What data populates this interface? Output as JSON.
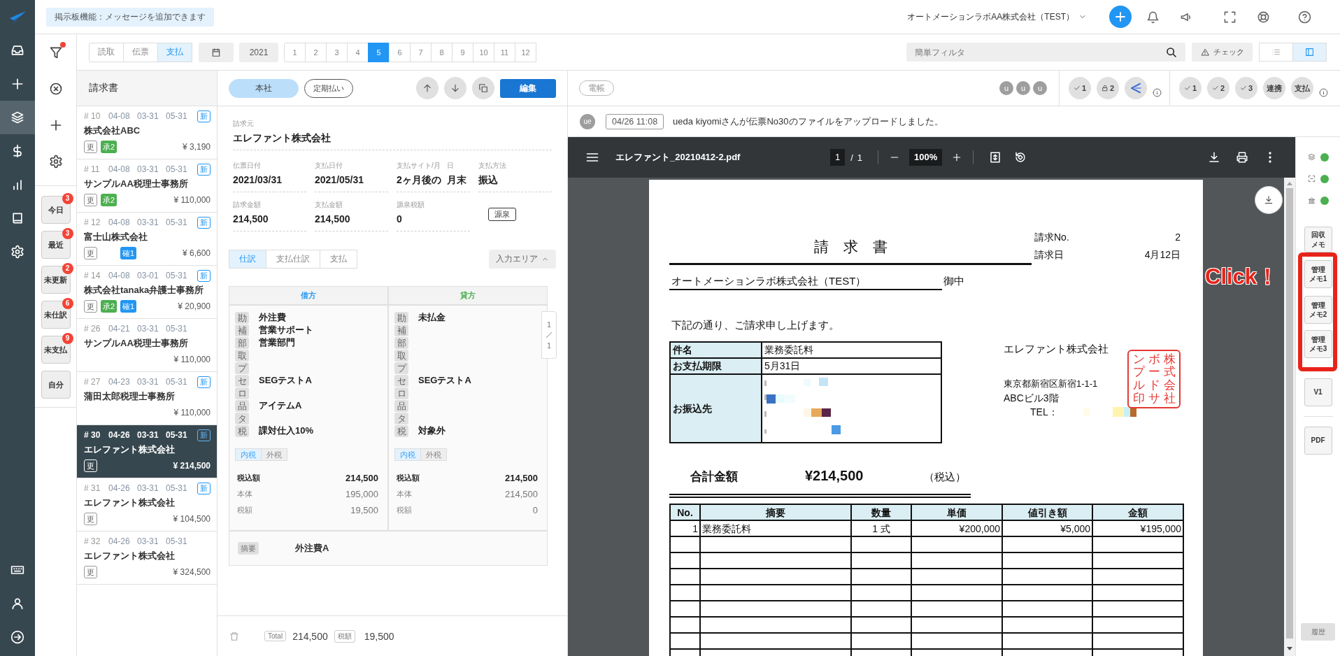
{
  "nav": {
    "items": [
      {
        "kind": "inbox",
        "selected": false
      },
      {
        "kind": "add",
        "selected": false
      },
      {
        "kind": "layers",
        "selected": true
      },
      {
        "kind": "dollar",
        "selected": false
      },
      {
        "kind": "chart",
        "selected": false
      },
      {
        "kind": "book",
        "selected": false
      },
      {
        "kind": "settings",
        "selected": false
      }
    ],
    "bottom_items": [
      {
        "kind": "keyboard"
      },
      {
        "kind": "user"
      },
      {
        "kind": "logout"
      }
    ]
  },
  "header": {
    "notice": "掲示板機能：メッセージを追加できます",
    "company": "オートメーションラボAA株式会社（TEST）"
  },
  "filters": {
    "filter_active": true,
    "quick": [
      {
        "label": "今日",
        "count": "3",
        "selected": false
      },
      {
        "label": "最近",
        "count": "3",
        "selected": false
      },
      {
        "label": "未更新",
        "count": "2",
        "selected": false
      },
      {
        "label": "未仕訳",
        "count": "6",
        "selected": false
      },
      {
        "label": "未支払",
        "count": "9",
        "selected": false
      },
      {
        "label": "自分",
        "selected": false
      }
    ]
  },
  "toolbar": {
    "sources": [
      {
        "label": "読取",
        "selected": false
      },
      {
        "label": "伝票",
        "selected": false
      },
      {
        "label": "支払",
        "selected": true
      }
    ],
    "year": "2021",
    "months": [
      {
        "label": "1",
        "selected": false
      },
      {
        "label": "2",
        "selected": false
      },
      {
        "label": "3",
        "selected": false
      },
      {
        "label": "4",
        "selected": false
      },
      {
        "label": "5",
        "selected": true
      },
      {
        "label": "6",
        "selected": false
      },
      {
        "label": "7",
        "selected": false
      },
      {
        "label": "8",
        "selected": false
      },
      {
        "label": "9",
        "selected": false
      },
      {
        "label": "10",
        "selected": false
      },
      {
        "label": "11",
        "selected": false
      },
      {
        "label": "12",
        "selected": false
      }
    ],
    "search": {
      "placeholder": "簡単フィルタ"
    },
    "check_button": "チェック",
    "views": [
      {
        "kind": "list",
        "selected": false
      },
      {
        "kind": "split",
        "selected": true
      }
    ]
  },
  "invoice_list": {
    "title": "請求書",
    "items": [
      {
        "number": "# 10",
        "dates": [
          "04-08",
          "03-31",
          "05-31"
        ],
        "badge": "新",
        "name": "株式会社ABC",
        "tags": [
          {
            "label": "更",
            "kind": "outline"
          },
          {
            "label": "承2",
            "kind": "approval"
          }
        ],
        "amount": "¥ 3,190",
        "selected": false
      },
      {
        "number": "# 11",
        "dates": [
          "04-08",
          "03-31",
          "05-31"
        ],
        "badge": "新",
        "name": "サンプルAA税理士事務所",
        "tags": [
          {
            "label": "更",
            "kind": "outline"
          },
          {
            "label": "承2",
            "kind": "approval"
          }
        ],
        "amount": "¥ 110,000",
        "selected": false
      },
      {
        "number": "# 12",
        "dates": [
          "04-08",
          "03-31",
          "05-31"
        ],
        "badge": "新",
        "name": "富士山株式会社",
        "tags": [
          {
            "label": "更",
            "kind": "outline"
          },
          {
            "label": "確1",
            "kind": "confirmed"
          }
        ],
        "amount": "¥ 6,600",
        "selected": false
      },
      {
        "number": "# 14",
        "dates": [
          "04-08",
          "03-01",
          "05-31"
        ],
        "badge": "新",
        "name": "株式会社tanaka弁護士事務所",
        "tags": [
          {
            "label": "更",
            "kind": "outline"
          },
          {
            "label": "承2",
            "kind": "approval"
          },
          {
            "label": "確1",
            "kind": "confirmed"
          }
        ],
        "amount": "¥ 20,900",
        "selected": false
      },
      {
        "number": "# 26",
        "dates": [
          "04-21",
          "03-31",
          "05-31"
        ],
        "name": "サンプルAA税理士事務所",
        "amount": "¥ 110,000",
        "selected": false
      },
      {
        "number": "# 27",
        "dates": [
          "04-23",
          "03-31",
          "05-31"
        ],
        "badge": "新",
        "name": "蒲田太郎税理士事務所",
        "amount": "¥ 110,000",
        "selected": false
      },
      {
        "number": "# 30",
        "dates": [
          "04-26",
          "03-31",
          "05-31"
        ],
        "badge": "新",
        "name": "エレファント株式会社",
        "tags": [
          {
            "label": "更",
            "kind": "outline"
          }
        ],
        "amount": "¥ 214,500",
        "selected": true
      },
      {
        "number": "# 31",
        "dates": [
          "04-26",
          "03-31",
          "05-31"
        ],
        "badge": "新",
        "name": "エレファント株式会社",
        "tags": [
          {
            "label": "更",
            "kind": "outline"
          }
        ],
        "amount": "¥ 104,500",
        "selected": false
      },
      {
        "number": "# 32",
        "dates": [
          "04-26",
          "03-31",
          "05-31"
        ],
        "name": "エレファント株式会社",
        "tags": [
          {
            "label": "更",
            "kind": "outline"
          }
        ],
        "amount": "¥ 324,500",
        "selected": false
      }
    ]
  },
  "detail": {
    "tags": [
      {
        "label": "本社",
        "selected": true
      },
      {
        "label": "定期払い",
        "selected": false
      }
    ],
    "edit_button": "編集",
    "vendor": {
      "label": "請求元",
      "value": "エレファント株式会社"
    },
    "dates": [
      {
        "label": "伝票日付",
        "value": "2021/03/31"
      },
      {
        "label": "支払日付",
        "value": "2021/05/31"
      },
      {
        "label": "支払サイト/月",
        "value": "2ヶ月後の"
      },
      {
        "label": "日",
        "value": "月末"
      },
      {
        "label": "支払方法",
        "value": "振込"
      }
    ],
    "amounts": [
      {
        "label": "請求金額",
        "value": "214,500"
      },
      {
        "label": "支払金額",
        "value": "214,500"
      },
      {
        "label": "源泉税額",
        "value": "0"
      }
    ],
    "withholding_button": "源泉",
    "tabs": [
      {
        "label": "仕訳",
        "selected": true
      },
      {
        "label": "支払仕訳",
        "selected": false
      },
      {
        "label": "支払",
        "selected": false
      }
    ],
    "input_area_button": "入力エリア",
    "journal": {
      "sides": [
        {
          "title": "借方",
          "kind": "debit",
          "rows": [
            {
              "tag": "勘",
              "value": "外注費"
            },
            {
              "tag": "補",
              "value": "営業サポート"
            },
            {
              "tag": "部",
              "value": "営業部門"
            },
            {
              "tag": "取"
            },
            {
              "tag": "プ"
            },
            {
              "tag": "セ",
              "value": "SEGテストA"
            },
            {
              "tag": "ロ"
            },
            {
              "tag": "品",
              "value": "アイテムA"
            },
            {
              "tag": "タ"
            },
            {
              "tag": "税",
              "value": "課対仕入10%"
            }
          ],
          "tax_modes": [
            {
              "label": "内税",
              "selected": true
            },
            {
              "label": "外税",
              "selected": false
            }
          ],
          "totals": [
            {
              "label": "税込額",
              "value": "214,500",
              "kind": "main"
            },
            {
              "label": "本体",
              "value": "195,000",
              "kind": "sub"
            },
            {
              "label": "税額",
              "value": "19,500",
              "kind": "sub"
            }
          ]
        },
        {
          "title": "貸方",
          "kind": "credit",
          "rows": [
            {
              "tag": "勘",
              "value": "未払金"
            },
            {
              "tag": "補"
            },
            {
              "tag": "部"
            },
            {
              "tag": "取"
            },
            {
              "tag": "プ"
            },
            {
              "tag": "セ",
              "value": "SEGテストA"
            },
            {
              "tag": "ロ"
            },
            {
              "tag": "品"
            },
            {
              "tag": "タ"
            },
            {
              "tag": "税",
              "value": "対象外"
            }
          ],
          "tax_modes": [
            {
              "label": "内税",
              "selected": true
            },
            {
              "label": "外税",
              "selected": false
            }
          ],
          "totals": [
            {
              "label": "税込額",
              "value": "214,500",
              "kind": "main"
            },
            {
              "label": "本体",
              "value": "214,500",
              "kind": "sub"
            },
            {
              "label": "税額",
              "value": "0",
              "kind": "sub"
            }
          ]
        }
      ],
      "memo": {
        "label": "摘要",
        "value": "外注費A"
      },
      "pager": {
        "current": "1",
        "total": "1"
      }
    },
    "footer": {
      "total_label": "Total",
      "total": "214,500",
      "tax_label": "税額",
      "tax": "19,500"
    }
  },
  "document_pane": {
    "doc_header": {
      "pill": "電帳",
      "users": [
        "u",
        "u",
        "u"
      ],
      "group_1": [
        {
          "kind": "check",
          "label": "1"
        },
        {
          "kind": "lock",
          "label": "2"
        },
        {
          "kind": "logo"
        }
      ],
      "group_2": [
        {
          "kind": "check",
          "label": "1"
        },
        {
          "kind": "check",
          "label": "2"
        },
        {
          "kind": "check",
          "label": "3"
        },
        {
          "kind": "text",
          "label": "連携"
        },
        {
          "kind": "text",
          "label": "支払"
        }
      ]
    },
    "activity": {
      "avatar": "ue",
      "time": "04/26 11:08",
      "message": "ueda kiyomiさんが伝票No30のファイルをアップロードしました。"
    },
    "viewer": {
      "file_name": "エレファント_20210412-2.pdf",
      "page": "1",
      "separator": "/",
      "page_count": "1",
      "zoom": "100%"
    },
    "document": {
      "title": "請　求　書",
      "meta": [
        {
          "label": "請求No.",
          "value": "2"
        },
        {
          "label": "請求日",
          "value": "4月12日"
        }
      ],
      "recipient": "オートメーションラボ株式会社（TEST）",
      "honorific": "御中",
      "intro": "下記の通り、ご請求申し上げます。",
      "info": [
        {
          "label": "件名",
          "value": "業務委託料"
        },
        {
          "label": "お支払期限",
          "value": "5月31日"
        },
        {
          "label": "お振込先",
          "redacted": true
        }
      ],
      "issuer": {
        "name": "エレファント株式会社",
        "address": "東京都新宿区新宿1-1-1",
        "building": "ABCビル3階",
        "tel_label": "TEL：",
        "tel_redacted": true,
        "seal": [
          "ンプル印",
          "ボードサ",
          "株式会社"
        ]
      },
      "total": {
        "label": "合計金額",
        "value": "¥214,500",
        "note": "（税込）"
      },
      "items": {
        "columns": [
          "No.",
          "摘要",
          "数量",
          "単価",
          "値引き額",
          "金額"
        ],
        "rows": [
          [
            "1",
            "業務委託料",
            "1 式",
            "¥200,000",
            "¥5,000",
            "¥195,000"
          ]
        ]
      }
    },
    "side_panel": {
      "status": [
        {
          "kind": "layers",
          "on": true
        },
        {
          "kind": "scan",
          "on": true
        },
        {
          "kind": "bank",
          "on": true
        }
      ],
      "memo_buttons": [
        "回収メモ",
        "管理メモ1",
        "管理メモ2",
        "管理メモ3"
      ],
      "version_button": "V1",
      "pdf_button": "PDF",
      "history_button": "履歴"
    },
    "annotation": {
      "text": "Click！"
    }
  }
}
